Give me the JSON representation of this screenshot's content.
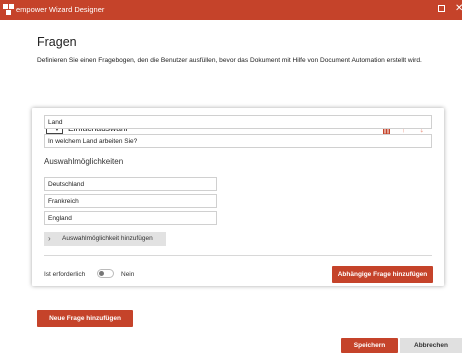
{
  "window": {
    "title": "empower Wizard Designer"
  },
  "page": {
    "heading": "Fragen",
    "intro": "Definieren Sie einen Fragebogen, den die Benutzer ausfüllen, bevor das Dokument mit Hilfe von Document Automation erstellt wird."
  },
  "question": {
    "type_label": "Einfachauswahl",
    "name": "Land",
    "text": "In welchem Land arbeiten Sie?",
    "options_heading": "Auswahlmöglichkeiten",
    "options": [
      "Deutschland",
      "Frankreich",
      "England"
    ],
    "add_option_label": "Auswahlmöglichkeit hinzufügen",
    "required_label": "Ist erforderlich",
    "required_value": "Nein",
    "dependent_button": "Abhängige Frage hinzufügen"
  },
  "actions": {
    "new_question": "Neue Frage hinzufügen",
    "save": "Speichern",
    "cancel": "Abbrechen"
  },
  "colors": {
    "accent": "#c5432a",
    "arrow_disabled": "#f0a696"
  }
}
